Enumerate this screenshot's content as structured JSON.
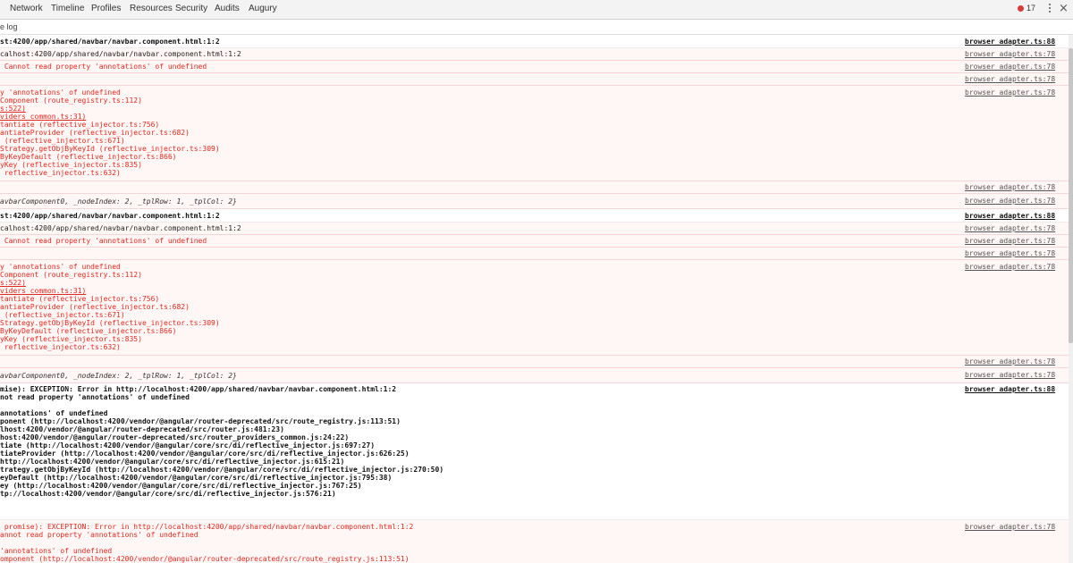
{
  "toolbar": {
    "tabs": [
      "Network",
      "Timeline",
      "Profiles",
      "Resources",
      "Security",
      "Audits",
      "Augury"
    ],
    "error_count": "17",
    "close_glyph": "×"
  },
  "subbar": {
    "label": "e log"
  },
  "console": {
    "messages": [
      {
        "lines": [
          "st:4200/app/shared/navbar/navbar.component.html:1:2"
        ],
        "source": "browser_adapter.ts:88"
      },
      {
        "lines": [
          "calhost:4200/app/shared/navbar/navbar.component.html:1:2"
        ],
        "source": "browser_adapter.ts:78"
      },
      {
        "lines": [
          " Cannot read property 'annotations' of undefined"
        ],
        "source": "browser_adapter.ts:78"
      },
      {
        "lines": [
          ""
        ],
        "source": "browser_adapter.ts:78"
      },
      {
        "lines": [
          "y 'annotations' of undefined",
          "Component (route_registry.ts:112)",
          "s:522)",
          "viders_common.ts:31)",
          "tantiate (reflective_injector.ts:756)",
          "antiateProvider (reflective_injector.ts:682)",
          " (reflective_injector.ts:671)",
          "Strategy.getObjByKeyId (reflective_injector.ts:309)",
          "ByKeyDefault (reflective_injector.ts:866)",
          "yKey (reflective_injector.ts:835)",
          " reflective_injector.ts:632)"
        ],
        "source": "browser_adapter.ts:78"
      },
      {
        "lines": [
          ""
        ],
        "source": "browser_adapter.ts:78"
      },
      {
        "lines": [
          "avbarComponent0, _nodeIndex: 2, _tplRow: 1, _tplCol: 2}"
        ],
        "source": "browser_adapter.ts:78"
      },
      {
        "lines": [
          "st:4200/app/shared/navbar/navbar.component.html:1:2"
        ],
        "source": "browser_adapter.ts:88"
      },
      {
        "lines": [
          "calhost:4200/app/shared/navbar/navbar.component.html:1:2"
        ],
        "source": "browser_adapter.ts:78"
      },
      {
        "lines": [
          " Cannot read property 'annotations' of undefined"
        ],
        "source": "browser_adapter.ts:78"
      },
      {
        "lines": [
          ""
        ],
        "source": "browser_adapter.ts:78"
      },
      {
        "lines": [
          "y 'annotations' of undefined",
          "Component (route_registry.ts:112)",
          "s:522)",
          "viders_common.ts:31)",
          "tantiate (reflective_injector.ts:756)",
          "antiateProvider (reflective_injector.ts:682)",
          " (reflective_injector.ts:671)",
          "Strategy.getObjByKeyId (reflective_injector.ts:309)",
          "ByKeyDefault (reflective_injector.ts:866)",
          "yKey (reflective_injector.ts:835)",
          " reflective_injector.ts:632)"
        ],
        "source": "browser_adapter.ts:78"
      },
      {
        "lines": [
          ""
        ],
        "source": "browser_adapter.ts:78"
      },
      {
        "lines": [
          "avbarComponent0, _nodeIndex: 2, _tplRow: 1, _tplCol: 2}"
        ],
        "source": "browser_adapter.ts:78"
      },
      {
        "lines": [
          "mise): EXCEPTION: Error in http://localhost:4200/app/shared/navbar/navbar.component.html:1:2",
          "not read property 'annotations' of undefined",
          "",
          "annotations' of undefined",
          "ponent (http://localhost:4200/vendor/@angular/router-deprecated/src/route_registry.js:113:51)",
          "lhost:4200/vendor/@angular/router-deprecated/src/router.js:481:23)",
          "host:4200/vendor/@angular/router-deprecated/src/router_providers_common.js:24:22)",
          "tiate (http://localhost:4200/vendor/@angular/core/src/di/reflective_injector.js:697:27)",
          "tiateProvider (http://localhost:4200/vendor/@angular/core/src/di/reflective_injector.js:626:25)",
          "http://localhost:4200/vendor/@angular/core/src/di/reflective_injector.js:615:21)",
          "trategy.getObjByKeyId (http://localhost:4200/vendor/@angular/core/src/di/reflective_injector.js:270:50)",
          "eyDefault (http://localhost:4200/vendor/@angular/core/src/di/reflective_injector.js:795:38)",
          "ey (http://localhost:4200/vendor/@angular/core/src/di/reflective_injector.js:767:25)",
          "tp://localhost:4200/vendor/@angular/core/src/di/reflective_injector.js:576:21)"
        ],
        "source": "browser_adapter.ts:88"
      },
      {
        "lines": [
          " promise): EXCEPTION: Error in http://localhost:4200/app/shared/navbar/navbar.component.html:1:2",
          "annot read property 'annotations' of undefined",
          "",
          "'annotations' of undefined",
          "omponent (http://localhost:4200/vendor/@angular/router-deprecated/src/route_registry.js:113:51)"
        ],
        "source": "browser_adapter.ts:78"
      }
    ]
  }
}
